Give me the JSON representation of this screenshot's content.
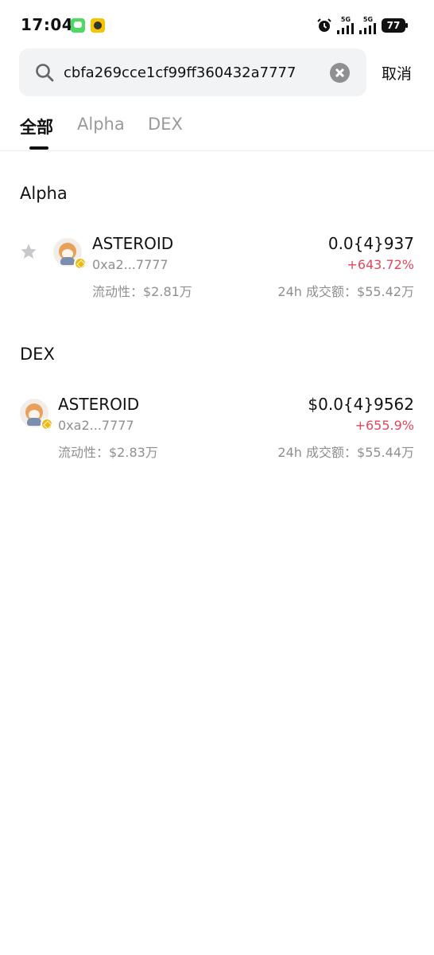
{
  "status_bar": {
    "time": "17:04",
    "signal_1": "5G",
    "signal_2": "5G",
    "battery": "77",
    "icons": [
      "messages-app-icon",
      "app-notification-icon",
      "alarm-icon",
      "signal-icon",
      "battery-icon"
    ]
  },
  "search": {
    "value": "cbfa269cce1cf99ff360432a7777",
    "placeholder": "",
    "cancel_label": "取消"
  },
  "tabs": [
    {
      "label": "全部",
      "active": true
    },
    {
      "label": "Alpha",
      "active": false
    },
    {
      "label": "DEX",
      "active": false
    }
  ],
  "alpha_section": {
    "title": "Alpha",
    "items": [
      {
        "name": "ASTEROID",
        "address": "0xa2...7777",
        "liquidity": "流动性：$2.81万",
        "price": "0.0{4}937",
        "change": "+643.72%",
        "volume": "24h 成交额：$55.42万"
      }
    ]
  },
  "dex_section": {
    "title": "DEX",
    "items": [
      {
        "name": "ASTEROID",
        "address": "0xa2...7777",
        "liquidity": "流动性：$2.83万",
        "price": "$0.0{4}9562",
        "change": "+655.9%",
        "volume": "24h 成交额：$55.44万"
      }
    ]
  },
  "colors": {
    "positive_change": "#e0475d",
    "secondary_text": "#8f8f8f",
    "search_bg": "#f2f3f5"
  }
}
